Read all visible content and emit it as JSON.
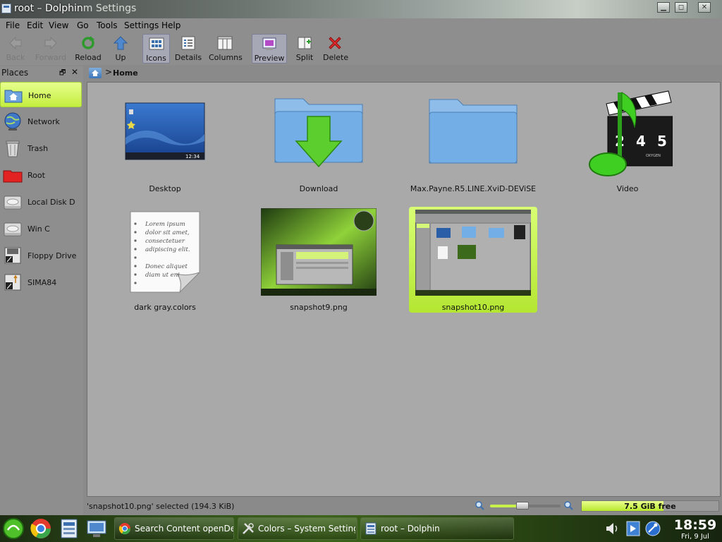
{
  "window": {
    "title": "root – Dolphin",
    "title_ghost": "m Settings",
    "minimize_glyph": "▁",
    "maximize_glyph": "◻",
    "close_glyph": "✕"
  },
  "menu": [
    "File",
    "Edit",
    "View",
    "Go",
    "Tools",
    "Settings",
    "Help"
  ],
  "toolbar": {
    "back": "Back",
    "forward": "Forward",
    "reload": "Reload",
    "up": "Up",
    "icons": "Icons",
    "details": "Details",
    "columns": "Columns",
    "preview": "Preview",
    "split": "Split",
    "delete": "Delete"
  },
  "places": {
    "title": "Places",
    "dock_glyph": "🗗",
    "close_glyph": "✕",
    "items": [
      {
        "label": "Home",
        "icon": "home-folder-icon"
      },
      {
        "label": "Network",
        "icon": "network-globe-icon"
      },
      {
        "label": "Trash",
        "icon": "trash-icon"
      },
      {
        "label": "Root",
        "icon": "red-folder-icon"
      },
      {
        "label": "Local Disk D",
        "icon": "hard-disk-icon"
      },
      {
        "label": "Win C",
        "icon": "hard-disk-icon"
      },
      {
        "label": "Floppy Drive",
        "icon": "floppy-drive-icon"
      },
      {
        "label": "SIMA84",
        "icon": "usb-drive-icon"
      }
    ]
  },
  "breadcrumb": {
    "separator": ">",
    "current": "Home"
  },
  "files": [
    {
      "name": "Desktop",
      "type": "desktop"
    },
    {
      "name": "Download",
      "type": "download-folder"
    },
    {
      "name": "Max.Payne.R5.LINE.XviD-DEViSE",
      "type": "folder"
    },
    {
      "name": "Video",
      "type": "video-folder"
    },
    {
      "name": "dark gray.colors",
      "type": "text"
    },
    {
      "name": "snapshot9.png",
      "type": "image"
    },
    {
      "name": "snapshot10.png",
      "type": "image"
    }
  ],
  "desktop_thumb_clock": "12:34",
  "clapper_numbers": [
    "2",
    "4",
    "5"
  ],
  "clapper_brand": "OXYGEN",
  "text_preview_lines": [
    "Lorem ipsum",
    "dolor sit amet,",
    "consectetuer",
    "adipiscing elit.",
    "",
    "Donec aliquet",
    "diam ut eni"
  ],
  "status": {
    "selection": "'snapshot10.png' selected (194.3 KiB)",
    "zoom_level": 0.46,
    "free_space": "7.5 GiB free",
    "used_fraction": 0.6
  },
  "taskbar": {
    "tasks": [
      {
        "label": "Search Content openDesktop.o",
        "icon": "chrome-icon"
      },
      {
        "label": "Colors – System Settings",
        "icon": "settings-tools-icon"
      },
      {
        "label": "root – Dolphin",
        "icon": "dolphin-icon"
      }
    ],
    "clock_time": "18:59",
    "clock_date": "Fri, 9 Jul"
  },
  "colors": {
    "selection": "#c5ee3f",
    "background": "#a9a9a9",
    "panel": "#8e8e8e"
  }
}
